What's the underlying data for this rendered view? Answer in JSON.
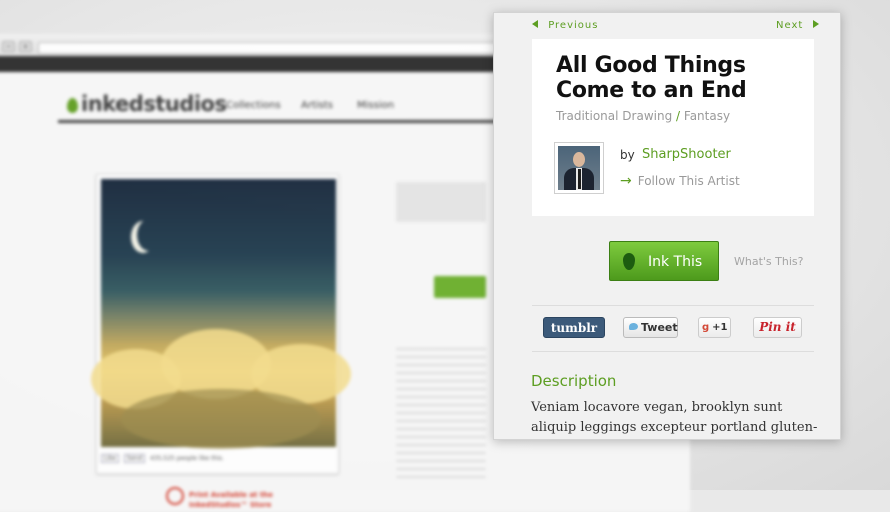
{
  "background_page": {
    "logo": "inkedstudios",
    "nav": [
      "Collections",
      "Artists",
      "Mission"
    ],
    "print_note": [
      "Print Available at the",
      "InkedStudios™ Store"
    ],
    "like_label": "Like",
    "send_label": "Send",
    "like_count": "435,525 people like this."
  },
  "card": {
    "previous_label": "Previous",
    "next_label": "Next",
    "title": "All Good Things Come to an End",
    "category": "Traditional Drawing",
    "subcategory": "Fantasy",
    "by_label": "by",
    "author": "SharpShooter",
    "follow_label": "Follow This Artist",
    "ink_label": "Ink This",
    "whats_this": "What's This?",
    "share": {
      "tumblr": "tumblr",
      "tweet": "Tweet",
      "gplus": "+1",
      "pinterest": "Pin it"
    },
    "description_title": "Description",
    "description_text": "Veniam locavore vegan, brooklyn sunt aliquip leggings excepteur portland gluten-free fixie sed sunt dolore"
  },
  "colors": {
    "accent_green": "#5d9e22",
    "tumblr_blue": "#3c5a7a",
    "alert_red": "#d23a2a"
  }
}
